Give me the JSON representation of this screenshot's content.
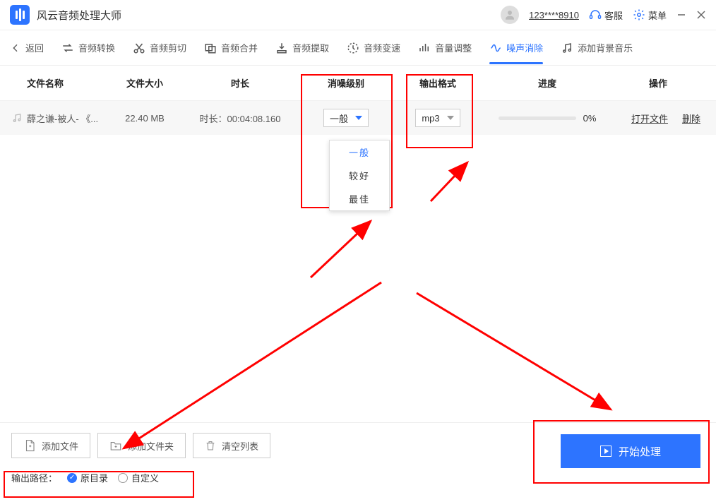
{
  "titlebar": {
    "app_name": "风云音频处理大师",
    "user_id": "123****8910",
    "service": "客服",
    "menu": "菜单"
  },
  "toolbar": {
    "back": "返回",
    "convert": "音频转换",
    "cut": "音频剪切",
    "merge": "音频合并",
    "extract": "音频提取",
    "speed": "音频变速",
    "volume": "音量调整",
    "denoise": "噪声消除",
    "bgm": "添加背景音乐"
  },
  "table": {
    "headers": {
      "name": "文件名称",
      "size": "文件大小",
      "duration": "时长",
      "level": "消噪级别",
      "format": "输出格式",
      "progress": "进度",
      "operation": "操作"
    },
    "row": {
      "filename": "薛之谦-被人- 《...",
      "size": "22.40 MB",
      "duration_label": "时长：00:04:08.160",
      "level_selected": "一般",
      "format_selected": "mp3",
      "progress_pct": "0%",
      "open_file": "打开文件",
      "delete": "删除"
    }
  },
  "dropdown": {
    "opt1": "一般",
    "opt2": "较好",
    "opt3": "最佳"
  },
  "bottom": {
    "add_file": "添加文件",
    "add_folder": "添加文件夹",
    "clear_list": "清空列表",
    "output_path_label": "输出路径：",
    "original_dir": "原目录",
    "custom": "自定义",
    "start": "开始处理"
  }
}
